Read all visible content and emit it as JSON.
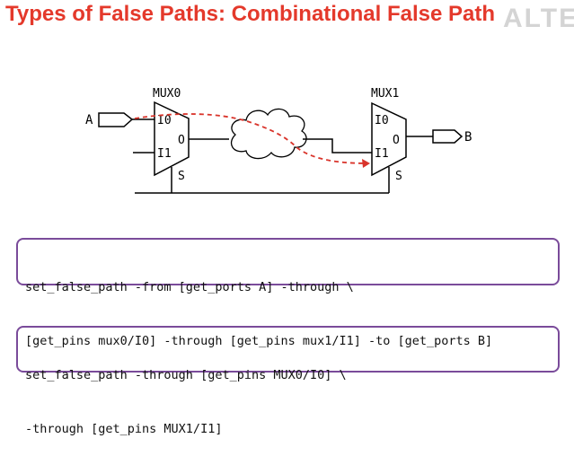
{
  "slide": {
    "title": "Types of False Paths: Combinational False Path",
    "logo_text": "ALTE"
  },
  "diagram": {
    "mux0": {
      "name": "MUX0",
      "in0": "I0",
      "in1": "I1",
      "out": "O",
      "sel": "S"
    },
    "mux1": {
      "name": "MUX1",
      "in0": "I0",
      "in1": "I1",
      "out": "O",
      "sel": "S"
    },
    "input_port": "A",
    "output_port": "B",
    "colors": {
      "false_path": "#d9342b",
      "wire": "#000000",
      "cloud_stroke": "#000000"
    }
  },
  "constraints": [
    {
      "lines": [
        "set_false_path -from [get_ports A] -through \\",
        "[get_pins mux0/I0] -through [get_pins mux1/I1] -to [get_ports B]"
      ]
    },
    {
      "lines": [
        "set_false_path -through [get_pins MUX0/I0] \\",
        "-through [get_pins MUX1/I1]"
      ]
    }
  ]
}
